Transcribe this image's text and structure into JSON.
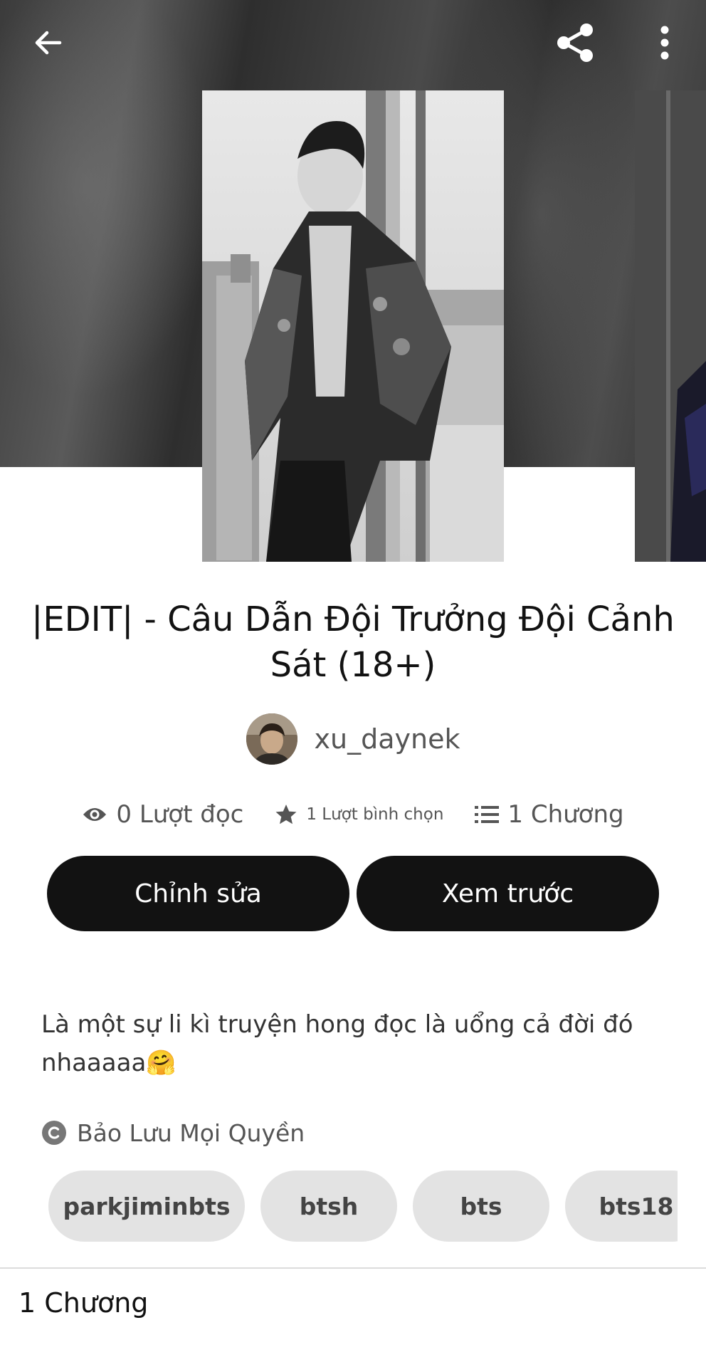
{
  "header": {
    "back_icon": "arrow-left-icon",
    "share_icon": "share-icon",
    "more_icon": "more-vertical-icon"
  },
  "story": {
    "title": "|EDIT| - Câu Dẫn Đội Trưởng Đội Cảnh Sát (18+)",
    "author": "xu_daynek",
    "stats": {
      "reads": "0 Lượt đọc",
      "votes": "1 Lượt bình chọn",
      "chapters": "1 Chương"
    },
    "buttons": {
      "edit": "Chỉnh sửa",
      "preview": "Xem trước"
    },
    "description": "Là một sự li kì truyện hong đọc là uổng cả đời đó nhaaaaa🤗",
    "copyright": "Bảo Lưu Mọi Quyền",
    "tags": [
      "parkjiminbts",
      "btsh",
      "bts",
      "bts18"
    ],
    "chapters_heading": "1 Chương"
  },
  "colors": {
    "button_bg": "#121212",
    "tag_bg": "#e3e3e3",
    "text_muted": "#555555"
  }
}
